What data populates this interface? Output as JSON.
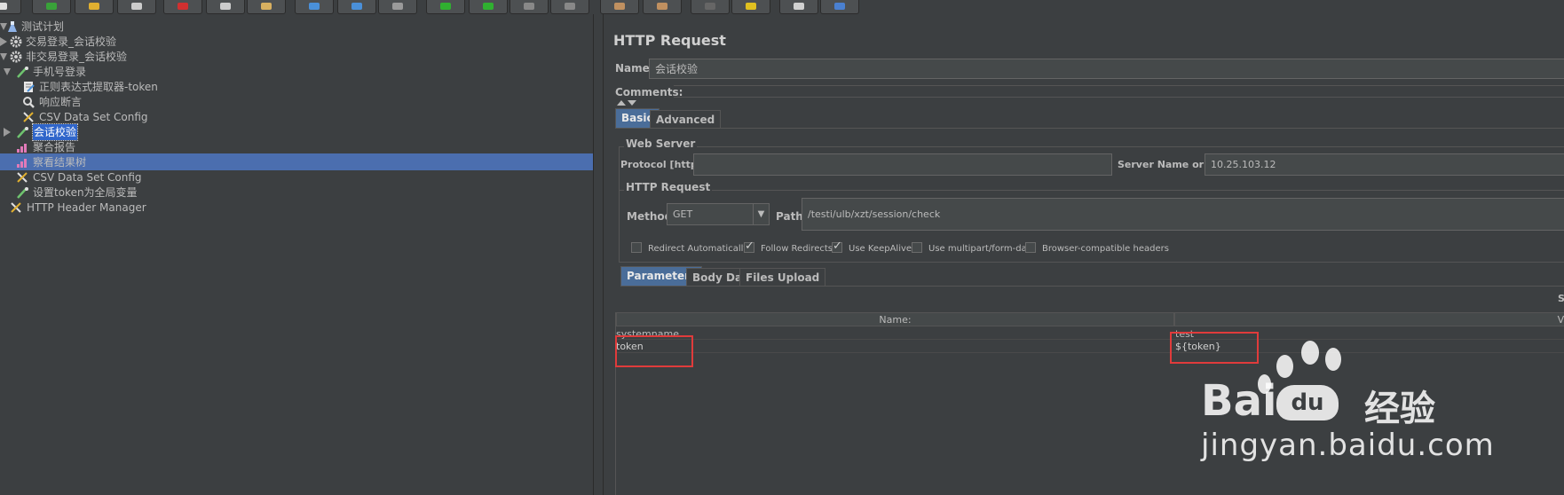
{
  "tree": {
    "items": [
      {
        "label": "测试计划",
        "icon": "test-plan-icon"
      },
      {
        "label": "交易登录_会话校验",
        "icon": "gear-icon"
      },
      {
        "label": "非交易登录_会话校验",
        "icon": "gear-icon"
      },
      {
        "label": "手机号登录",
        "icon": "sampler-icon"
      },
      {
        "label": "正则表达式提取器-token",
        "icon": "extractor-icon"
      },
      {
        "label": "响应断言",
        "icon": "assertion-icon"
      },
      {
        "label": "CSV Data Set Config",
        "icon": "wrench-icon"
      },
      {
        "label": "会话校验",
        "icon": "sampler-icon"
      },
      {
        "label": "聚合报告",
        "icon": "graph-icon"
      },
      {
        "label": "察看结果树",
        "icon": "graph-icon"
      },
      {
        "label": "CSV Data Set Config",
        "icon": "wrench-icon"
      },
      {
        "label": "设置token为全局变量",
        "icon": "sampler-icon"
      },
      {
        "label": "HTTP Header Manager",
        "icon": "wrench-icon"
      }
    ]
  },
  "panel": {
    "title": "HTTP Request",
    "name_label": "Name:",
    "name_value": "会话校验",
    "comments_label": "Comments:",
    "tabs": {
      "basic": "Basic",
      "advanced": "Advanced"
    },
    "web_server": {
      "legend": "Web Server",
      "protocol_label": "Protocol [http]:",
      "protocol_value": "",
      "server_label": "Server Name or IP:",
      "server_value": "10.25.103.12"
    },
    "http_request": {
      "legend": "HTTP Request",
      "method_label": "Method:",
      "method_value": "GET",
      "path_label": "Path:",
      "path_value": "/testi/ulb/xzt/session/check"
    },
    "checkboxes": [
      {
        "label": "Redirect Automatically",
        "checked": false
      },
      {
        "label": "Follow Redirects",
        "checked": true
      },
      {
        "label": "Use KeepAlive",
        "checked": true
      },
      {
        "label": "Use multipart/form-data",
        "checked": false
      },
      {
        "label": "Browser-compatible headers",
        "checked": false
      }
    ],
    "sub_tabs": {
      "parameters": "Parameters",
      "body": "Body Data",
      "files": "Files Upload"
    },
    "send_label": "S",
    "table": {
      "headers": [
        "Name:",
        "Va"
      ],
      "rows": [
        {
          "name": "systemname",
          "value": "test"
        },
        {
          "name": "token",
          "value": "${token}"
        }
      ]
    }
  },
  "watermark": {
    "brand_left": "Bai",
    "brand_mid": "du",
    "brand_cn": "经验",
    "url": "jingyan.baidu.com"
  },
  "colors": {
    "background": "#3c3f41",
    "selection": "#4b6eaf",
    "highlight_box": "#e03b3b"
  }
}
